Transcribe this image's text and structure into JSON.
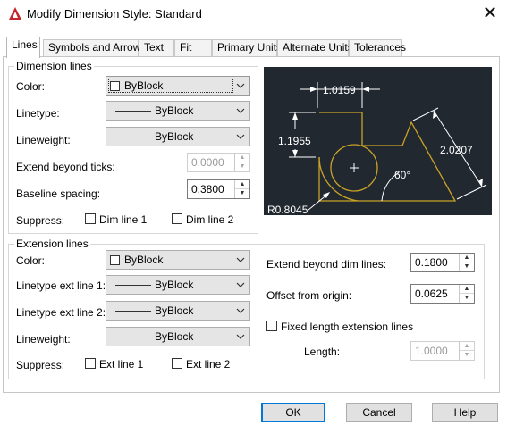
{
  "window": {
    "title": "Modify Dimension Style: Standard",
    "close_glyph": "✕",
    "icon": "autocad-icon",
    "accent": "#0078d7"
  },
  "tabs": [
    {
      "label": "Lines",
      "active": true
    },
    {
      "label": "Symbols and Arrows",
      "active": false
    },
    {
      "label": "Text",
      "active": false
    },
    {
      "label": "Fit",
      "active": false
    },
    {
      "label": "Primary Units",
      "active": false
    },
    {
      "label": "Alternate Units",
      "active": false
    },
    {
      "label": "Tolerances",
      "active": false
    }
  ],
  "dimension_lines": {
    "title": "Dimension lines",
    "color_label": "Color:",
    "color_value": "ByBlock",
    "linetype_label": "Linetype:",
    "linetype_value": "ByBlock",
    "lineweight_label": "Lineweight:",
    "lineweight_value": "ByBlock",
    "extend_ticks_label": "Extend beyond ticks:",
    "extend_ticks_value": "0.0000",
    "baseline_label": "Baseline spacing:",
    "baseline_value": "0.3800",
    "suppress_label": "Suppress:",
    "dim_line_1": "Dim line 1",
    "dim_line_2": "Dim line 2"
  },
  "extension_lines": {
    "title": "Extension lines",
    "color_label": "Color:",
    "color_value": "ByBlock",
    "linetype1_label": "Linetype ext line 1:",
    "linetype1_value": "ByBlock",
    "linetype2_label": "Linetype ext line 2:",
    "linetype2_value": "ByBlock",
    "lineweight_label": "Lineweight:",
    "lineweight_value": "ByBlock",
    "suppress_label": "Suppress:",
    "ext_line_1": "Ext line 1",
    "ext_line_2": "Ext line 2",
    "extend_beyond_label": "Extend beyond dim lines:",
    "extend_beyond_value": "0.1800",
    "offset_label": "Offset from origin:",
    "offset_value": "0.0625",
    "fixed_length_label": "Fixed length extension lines",
    "length_label": "Length:",
    "length_value": "1.0000"
  },
  "preview": {
    "dim_top": "1.0159",
    "dim_left": "1.1955",
    "dim_right": "2.0207",
    "angle": "60°",
    "radius": "R0.8045",
    "bg_color": "#212830",
    "dim_color": "#ffffff",
    "geometry_color": "#c9a227"
  },
  "buttons": {
    "ok": "OK",
    "cancel": "Cancel",
    "help": "Help"
  }
}
